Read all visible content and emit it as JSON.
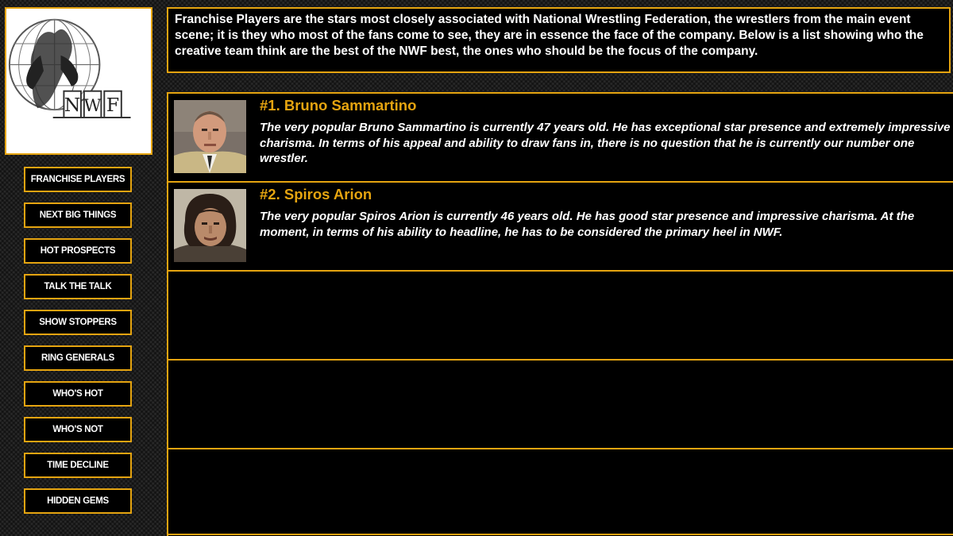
{
  "logo": {
    "letters": [
      "N",
      "W",
      "F"
    ]
  },
  "nav": {
    "items": [
      {
        "label": "FRANCHISE PLAYERS"
      },
      {
        "label": "NEXT BIG THINGS"
      },
      {
        "label": "HOT PROSPECTS"
      },
      {
        "label": "TALK THE TALK"
      },
      {
        "label": "SHOW STOPPERS"
      },
      {
        "label": "RING GENERALS"
      },
      {
        "label": "WHO'S HOT"
      },
      {
        "label": "WHO'S NOT"
      },
      {
        "label": "TIME DECLINE"
      },
      {
        "label": "HIDDEN GEMS"
      }
    ]
  },
  "intro": {
    "text": "Franchise Players are the stars most closely associated with National Wrestling Federation, the wrestlers from the main event scene; it is they who most of the fans come to see, they are in essence the face of the company. Below is a list showing who the creative team think are the best of the NWF best, the ones who should be the focus of the company."
  },
  "players": [
    {
      "rank_name": "#1. Bruno Sammartino",
      "description": "The very popular Bruno Sammartino is currently 47 years old. He has exceptional star presence and extremely impressive charisma. In terms of his appeal and ability to draw fans in, there is no question that he is currently our number one wrestler."
    },
    {
      "rank_name": "#2. Spiros Arion",
      "description": "The very popular Spiros Arion is currently 46 years old. He has good star presence and impressive charisma. At the moment, in terms of his ability to headline, he has to be considered the primary heel in NWF."
    }
  ],
  "colors": {
    "accent": "#e5a410",
    "panel": "#000000",
    "text": "#ffffff"
  }
}
